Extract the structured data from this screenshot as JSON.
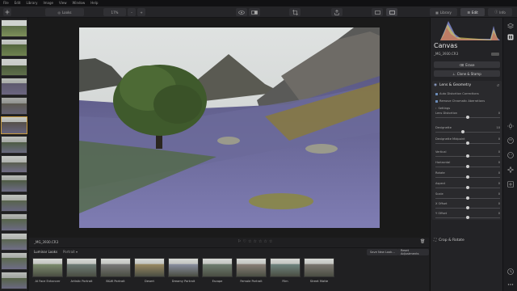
{
  "menu": [
    "File",
    "Edit",
    "Library",
    "Image",
    "View",
    "Window",
    "Help"
  ],
  "toolbar": {
    "looks_label": "Looks",
    "zoom_value": "17%",
    "zoom_minus": "–",
    "zoom_plus": "+",
    "library_label": "Library",
    "edit_label": "Edit",
    "info_label": "Info"
  },
  "infobar": {
    "filename": "_MG_3930.CR3",
    "flag": "⚐",
    "heart": "♡",
    "stars": [
      "☆",
      "☆",
      "☆",
      "☆",
      "☆"
    ],
    "trash": "🗑"
  },
  "looks": {
    "tab_label": "Luminar Looks",
    "category": "Portrait",
    "save_label": "Save New Look...",
    "reset_label": "Reset Adjustments",
    "items": [
      {
        "label": "AI Face Enhancer",
        "tint": "#7c8c6e"
      },
      {
        "label": "Artistic Portrait",
        "tint": "#6f7d78"
      },
      {
        "label": "B&W Portrait",
        "tint": "#7a7a7a"
      },
      {
        "label": "Desert",
        "tint": "#9a8a63"
      },
      {
        "label": "Dreamy Portrait",
        "tint": "#8a8fa0"
      },
      {
        "label": "Escape",
        "tint": "#6f7e70"
      },
      {
        "label": "Female Portrait",
        "tint": "#8a8078"
      },
      {
        "label": "Film",
        "tint": "#6f8580"
      },
      {
        "label": "Street Matte",
        "tint": "#7b7670"
      }
    ]
  },
  "panel": {
    "title": "Canvas",
    "filename": "_MG_3930.CR3",
    "erase_label": "Erase",
    "clone_label": "Clone & Stamp",
    "section_title": "Lens & Geometry",
    "checks": [
      "Auto Distortion Corrections",
      "Remove Chromatic Aberrations",
      "Settings"
    ],
    "sliders": [
      {
        "label": "Lens Distortion",
        "value": "0",
        "level": 0.5
      },
      {
        "label": "Devignette",
        "value": "10",
        "level": 0.43
      },
      {
        "label": "Devignette Midpoint",
        "value": "0",
        "level": 0.5
      },
      {
        "label": "Vertical",
        "value": "0",
        "level": 0.5
      },
      {
        "label": "Horizontal",
        "value": "0",
        "level": 0.5
      },
      {
        "label": "Rotate",
        "value": "0",
        "level": 0.5
      },
      {
        "label": "Aspect",
        "value": "0",
        "level": 0.5
      },
      {
        "label": "Scale",
        "value": "0",
        "level": 0.5
      },
      {
        "label": "X Offset",
        "value": "0",
        "level": 0.5
      },
      {
        "label": "Y Offset",
        "value": "0",
        "level": 0.5
      }
    ],
    "crop_label": "Crop & Rotate"
  },
  "colors": {
    "accent": "#c89a3d",
    "bg": "#1b1b1d",
    "panel": "#232326"
  }
}
